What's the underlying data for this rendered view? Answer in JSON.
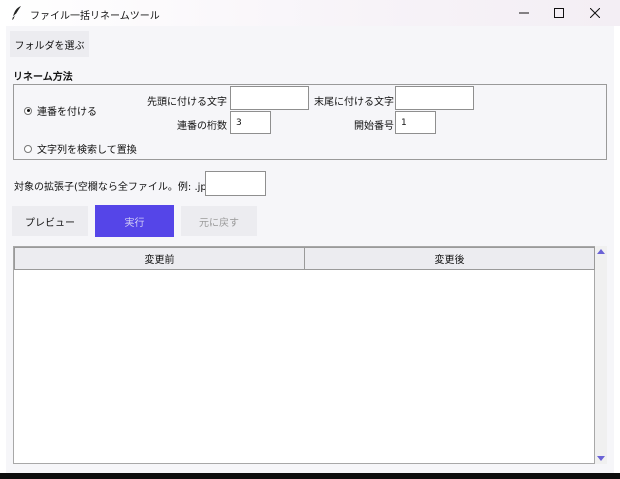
{
  "window": {
    "title": "ファイル一括リネームツール",
    "icons": {
      "app": "feather-pen-icon",
      "minimize": "minimize-icon",
      "maximize": "maximize-icon",
      "close": "close-icon"
    }
  },
  "toolbar": {
    "select_folder_label": "フォルダを選ぶ"
  },
  "rename_method": {
    "section_label": "リネーム方法",
    "options": [
      {
        "label": "連番を付ける",
        "selected": true
      },
      {
        "label": "文字列を検索して置換",
        "selected": false
      }
    ],
    "prefix": {
      "label": "先頭に付ける文字",
      "value": ""
    },
    "suffix": {
      "label": "末尾に付ける文字",
      "value": ""
    },
    "digits": {
      "label": "連番の桁数",
      "value": "3"
    },
    "start_number": {
      "label": "開始番号",
      "value": "1"
    }
  },
  "extension_filter": {
    "label": "対象の拡張子(空欄なら全ファイル。例: .jpg)",
    "value": ""
  },
  "actions": {
    "preview_label": "プレビュー",
    "execute_label": "実行",
    "undo_label": "元に戻す"
  },
  "table": {
    "columns": [
      "変更前",
      "変更後"
    ],
    "rows": []
  },
  "colors": {
    "accent": "#5545e8",
    "client_bg": "#f6f6f9",
    "button_bg": "#ececf0",
    "scroll_arrow": "#6b63d6"
  }
}
